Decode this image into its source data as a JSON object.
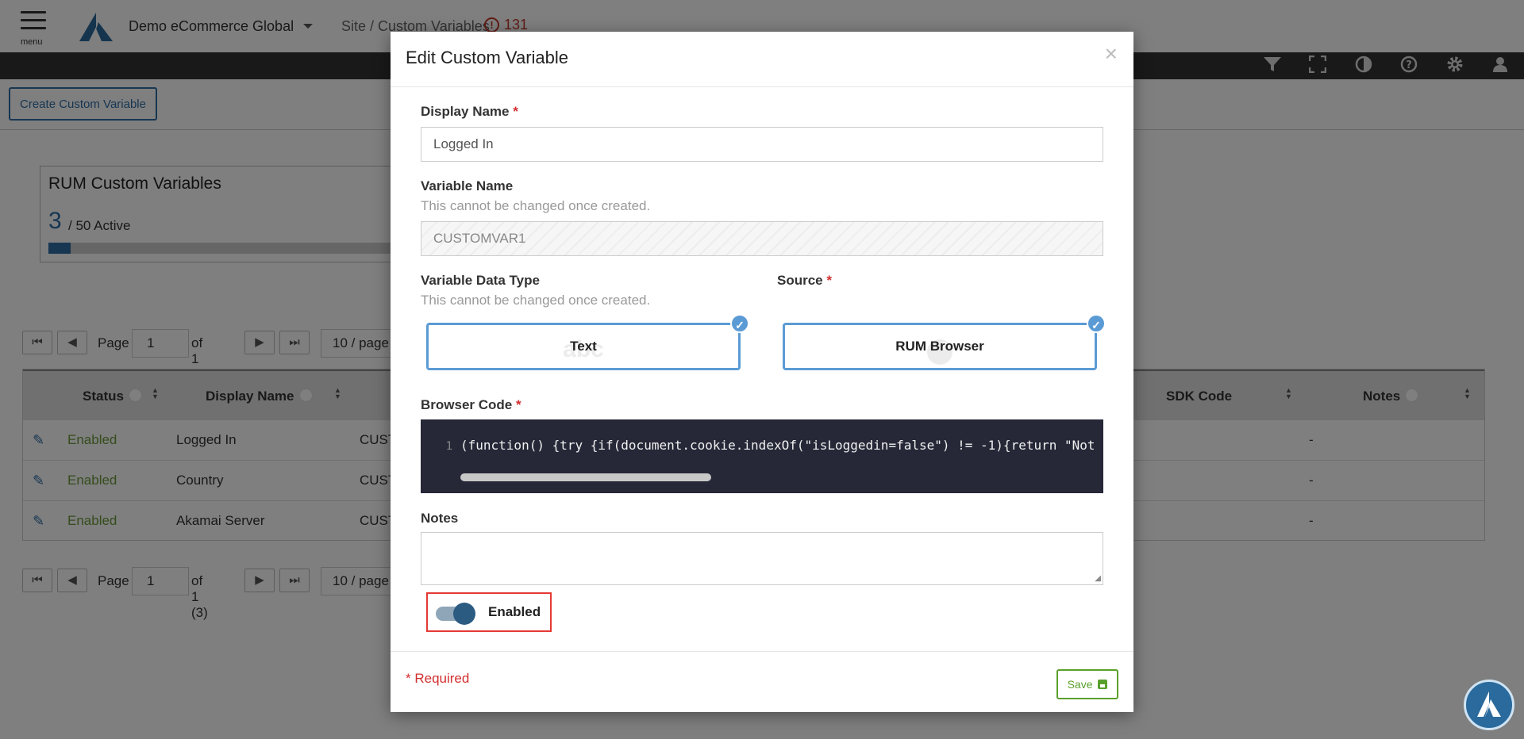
{
  "app": {
    "menu_label": "menu",
    "title": "Demo eCommerce Global",
    "breadcrumb": "Site / Custom Variables",
    "alert_count": "131"
  },
  "toolbar": {
    "icons": [
      "filter-icon",
      "fullscreen-icon",
      "contrast-icon",
      "help-icon",
      "settings-icon",
      "user-icon"
    ]
  },
  "actions": {
    "create_label": "Create Custom Variable"
  },
  "stats": {
    "title": "RUM Custom Variables",
    "active_count": "3",
    "active_text": "/ 50 Active",
    "active_fraction": 0.06
  },
  "pager": {
    "page_label": "Page",
    "page_value": "1",
    "of_text": "of 1 (3)",
    "page_size": "10 / page"
  },
  "table": {
    "headers": {
      "status": "Status",
      "display_name": "Display Name",
      "sdk_code": "SDK Code",
      "notes": "Notes"
    },
    "rows": [
      {
        "status": "Enabled",
        "display_name": "Logged In",
        "variable": "CUST",
        "notes": "-"
      },
      {
        "status": "Enabled",
        "display_name": "Country",
        "variable": "CUST",
        "notes": "-"
      },
      {
        "status": "Enabled",
        "display_name": "Akamai Server",
        "variable": "CUST",
        "notes": "-"
      }
    ]
  },
  "modal": {
    "title": "Edit Custom Variable",
    "close": "×",
    "display_name_label": "Display Name",
    "display_name_value": "Logged In",
    "variable_name_label": "Variable Name",
    "variable_name_hint": "This cannot be changed once created.",
    "variable_name_value": "CUSTOMVAR1",
    "data_type_label": "Variable Data Type",
    "data_type_hint": "This cannot be changed once created.",
    "data_type_value": "Text",
    "data_type_watermark": "abc",
    "source_label": "Source",
    "source_value": "RUM Browser",
    "browser_code_label": "Browser Code",
    "code_line_number": "1",
    "code_text": "(function() {try {if(document.cookie.indexOf(\"isLoggedin=false\") != -1){return \"Not",
    "notes_label": "Notes",
    "notes_value": "",
    "enabled_label": "Enabled",
    "enabled": true,
    "required_star": "*",
    "required_note": "* Required",
    "save_label": "Save"
  },
  "colors": {
    "accent": "#2e6da4",
    "choice_border": "#5b9bd5",
    "enabled_text": "#6a9a3a",
    "required": "#d32f2f",
    "save": "#5aa02c",
    "highlight": "#e53935"
  }
}
